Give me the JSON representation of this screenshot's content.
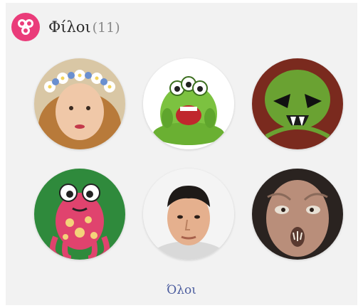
{
  "header": {
    "title": "Φίλοι",
    "count": "(11)",
    "icon": "friends-icon",
    "accent": "#ea3c7a"
  },
  "friends": [
    {
      "avatar": "girl-flower-crown"
    },
    {
      "avatar": "green-three-eyed-monster"
    },
    {
      "avatar": "green-alien-mask"
    },
    {
      "avatar": "pink-spotted-monster"
    },
    {
      "avatar": "man-portrait"
    },
    {
      "avatar": "creature-face"
    }
  ],
  "footer": {
    "all_link": "Όλοι"
  },
  "colors": {
    "link": "#4b5c9e",
    "panel_bg": "#f2f2f2"
  }
}
